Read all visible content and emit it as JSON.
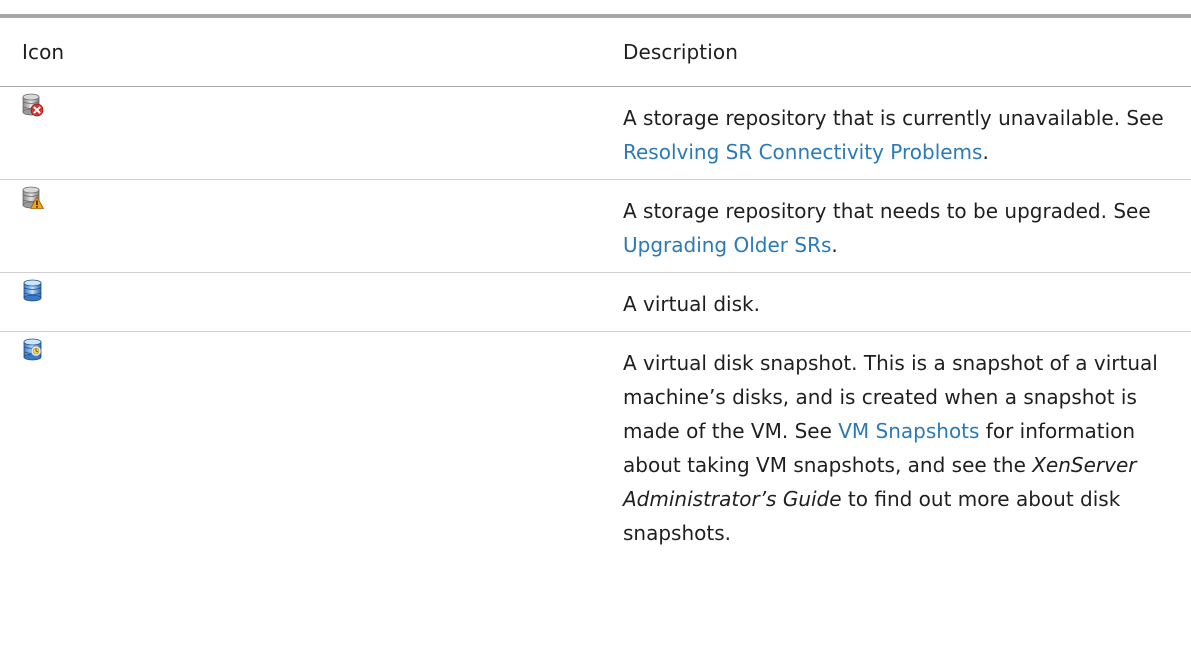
{
  "table": {
    "headers": {
      "icon": "Icon",
      "description": "Description"
    },
    "rows": [
      {
        "icon": "storage-repository-unavailable-icon",
        "text_1": "A storage repository that is currently unavailable.  See ",
        "link": "Resolving SR Connectivity Problems",
        "text_2": "."
      },
      {
        "icon": "storage-repository-upgrade-icon",
        "text_1": "A storage repository that needs to be upgraded.  See ",
        "link": "Upgrading Older SRs",
        "text_2": "."
      },
      {
        "icon": "virtual-disk-icon",
        "text_1": "A virtual disk."
      },
      {
        "icon": "virtual-disk-snapshot-icon",
        "text_1": "A virtual disk snapshot. This is a snapshot of a virtual machine’s disks, and is created when a snapshot is made of the VM. See ",
        "link": "VM Snapshots",
        "text_2": " for information about taking VM snapshots, and see the ",
        "emphasis": "XenServer Administrator’s Guide",
        "text_3": " to find out more about disk snapshots."
      }
    ]
  },
  "colors": {
    "link": "#2a7ab8",
    "rule": "#a8a8a8",
    "text": "#1f1f1f"
  }
}
